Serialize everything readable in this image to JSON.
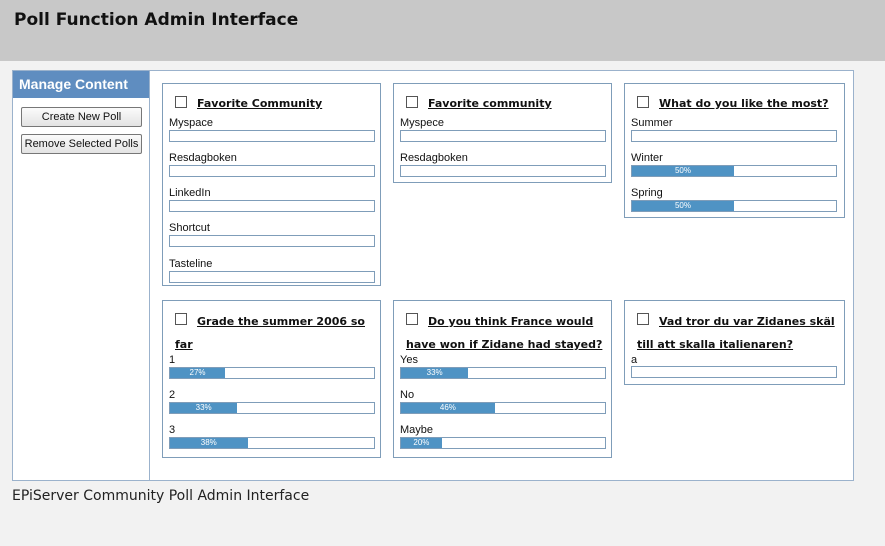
{
  "header": {
    "title": "Poll Function Admin Interface"
  },
  "sidebar": {
    "title": "Manage Content",
    "create_label": "Create New Poll",
    "remove_label": "Remove Selected Polls"
  },
  "polls": [
    {
      "title": "Favorite Community",
      "options": [
        {
          "label": "Myspace",
          "percent": null
        },
        {
          "label": "Resdagboken",
          "percent": null
        },
        {
          "label": "LinkedIn",
          "percent": null
        },
        {
          "label": "Shortcut",
          "percent": null
        },
        {
          "label": "Tasteline",
          "percent": null
        }
      ]
    },
    {
      "title": "Favorite community",
      "options": [
        {
          "label": "Myspece",
          "percent": null
        },
        {
          "label": "Resdagboken",
          "percent": null
        }
      ]
    },
    {
      "title": "What do you like the most?",
      "options": [
        {
          "label": "Summer",
          "percent": null
        },
        {
          "label": "Winter",
          "percent": 50,
          "percent_text": "50%"
        },
        {
          "label": "Spring",
          "percent": 50,
          "percent_text": "50%"
        }
      ]
    },
    {
      "title": "Grade the summer 2006 so far",
      "title_line1": "Grade the summer 2006 so",
      "title_line2": "far",
      "options": [
        {
          "label": "1",
          "percent": 27,
          "percent_text": "27%"
        },
        {
          "label": "2",
          "percent": 33,
          "percent_text": "33%"
        },
        {
          "label": "3",
          "percent": 38,
          "percent_text": "38%"
        }
      ]
    },
    {
      "title": "Do you think France would have won if Zidane had stayed?",
      "title_line1": "Do you think France would",
      "title_line2": "have won if Zidane had stayed?",
      "options": [
        {
          "label": "Yes",
          "percent": 33,
          "percent_text": "33%"
        },
        {
          "label": "No",
          "percent": 46,
          "percent_text": "46%"
        },
        {
          "label": "Maybe",
          "percent": 20,
          "percent_text": "20%"
        }
      ]
    },
    {
      "title": "Vad tror du var Zidanes skäl till att skalla italienaren?",
      "title_line1": "Vad tror du var Zidanes skäl",
      "title_line2": "till att skalla italienaren?",
      "options": [
        {
          "label": "a",
          "percent": null
        }
      ]
    }
  ],
  "caption": "EPiServer Community Poll Admin Interface",
  "colors": {
    "bar_fill": "#4f93c4",
    "sidebar_title_bg": "#5f8dc0",
    "header_bg": "#c8c8c8"
  }
}
